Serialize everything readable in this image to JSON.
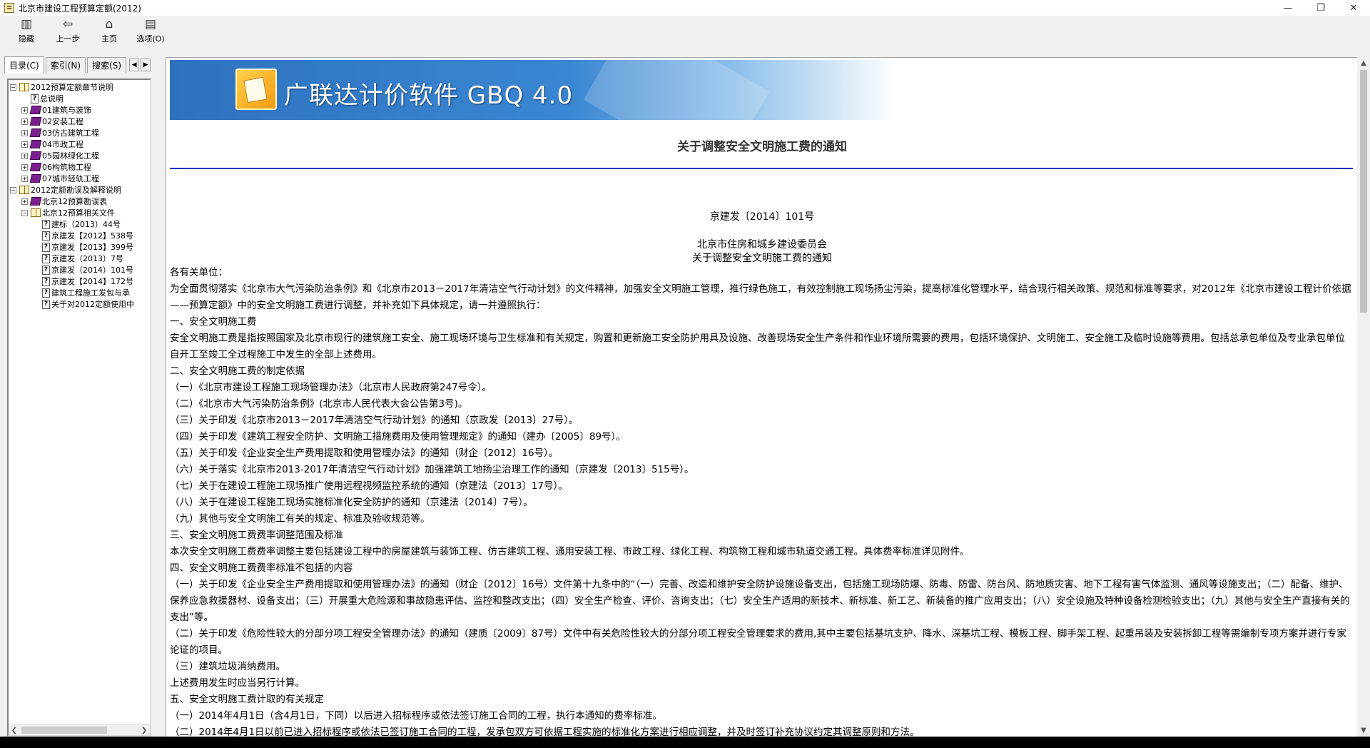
{
  "window": {
    "title": "北京市建设工程预算定额(2012)",
    "minimize": "—",
    "restore": "❐",
    "close": "✕"
  },
  "toolbar": {
    "hide": "隐藏",
    "back": "上一步",
    "home": "主页",
    "options": "选项(O)"
  },
  "nav": {
    "tabs": [
      "目录(C)",
      "索引(N)",
      "搜索(S)"
    ],
    "tree": [
      {
        "level": 0,
        "expander": "⊟",
        "icon": "openbook",
        "label": "2012预算定额章节说明"
      },
      {
        "level": 1,
        "expander": "",
        "icon": "help",
        "label": "总说明"
      },
      {
        "level": 1,
        "expander": "⊞",
        "icon": "book",
        "label": "01建筑与装饰"
      },
      {
        "level": 1,
        "expander": "⊞",
        "icon": "book",
        "label": "02安装工程"
      },
      {
        "level": 1,
        "expander": "⊞",
        "icon": "book",
        "label": "03仿古建筑工程"
      },
      {
        "level": 1,
        "expander": "⊞",
        "icon": "book",
        "label": "04市政工程"
      },
      {
        "level": 1,
        "expander": "⊞",
        "icon": "book",
        "label": "05园林绿化工程"
      },
      {
        "level": 1,
        "expander": "⊞",
        "icon": "book",
        "label": "06构筑物工程"
      },
      {
        "level": 1,
        "expander": "⊞",
        "icon": "book",
        "label": "07城市轻轨工程"
      },
      {
        "level": 0,
        "expander": "⊟",
        "icon": "openbook",
        "label": "2012定额勘误及解释说明"
      },
      {
        "level": 1,
        "expander": "⊞",
        "icon": "book",
        "label": "北京12预算勘误表"
      },
      {
        "level": 1,
        "expander": "⊟",
        "icon": "openbook",
        "label": "北京12预算相关文件"
      },
      {
        "level": 2,
        "expander": "",
        "icon": "help",
        "label": "建标（2013）44号"
      },
      {
        "level": 2,
        "expander": "",
        "icon": "help",
        "label": "京建发【2012】538号"
      },
      {
        "level": 2,
        "expander": "",
        "icon": "help",
        "label": "京建发【2013】399号"
      },
      {
        "level": 2,
        "expander": "",
        "icon": "help",
        "label": "京建发（2013）7号"
      },
      {
        "level": 2,
        "expander": "",
        "icon": "help",
        "label": "京建发（2014）101号"
      },
      {
        "level": 2,
        "expander": "",
        "icon": "help",
        "label": "京建发【2014】172号"
      },
      {
        "level": 2,
        "expander": "",
        "icon": "help",
        "label": "建筑工程施工发包与承"
      },
      {
        "level": 2,
        "expander": "",
        "icon": "help",
        "label": "关于对2012定额使用中"
      }
    ]
  },
  "content": {
    "brand": "广联达计价软件 GBQ 4.0",
    "doc_title": "关于调整安全文明施工费的通知",
    "doc_number": "京建发〔2014〕101号",
    "issuer": "北京市住房和城乡建设委员会",
    "subtitle": "关于调整安全文明施工费的通知",
    "paragraphs": [
      "各有关单位：",
      "为全面贯彻落实《北京市大气污染防治条例》和《北京市2013－2017年清洁空气行动计划》的文件精神，加强安全文明施工管理，推行绿色施工，有效控制施工现场扬尘污染，提高标准化管理水平，结合现行相关政策、规范和标准等要求，对2012年《北京市建设工程计价依据——预算定额》中的安全文明施工费进行调整，并补充如下具体规定，请一并遵照执行：",
      "一、安全文明施工费",
      "安全文明施工费是指按照国家及北京市现行的建筑施工安全、施工现场环境与卫生标准和有关规定，购置和更新施工安全防护用具及设施、改善现场安全生产条件和作业环境所需要的费用，包括环境保护、文明施工、安全施工及临时设施等费用。包括总承包单位及专业承包单位自开工至竣工全过程施工中发生的全部上述费用。",
      "二、安全文明施工费的制定依据",
      "（一）《北京市建设工程施工现场管理办法》（北京市人民政府第247号令）。",
      "（二）《北京市大气污染防治条例》(北京市人民代表大会公告第3号)。",
      "（三）关于印发《北京市2013－2017年清洁空气行动计划》的通知（京政发〔2013〕27号）。",
      "（四）关于印发《建筑工程安全防护、文明施工措施费用及使用管理规定》的通知（建办〔2005〕89号）。",
      "（五）关于印发《企业安全生产费用提取和使用管理办法》的通知（财企〔2012〕16号）。",
      "（六）关于落实《北京市2013-2017年清洁空气行动计划》加强建筑工地扬尘治理工作的通知（京建发〔2013〕515号）。",
      "（七）关于在建设工程施工现场推广使用远程视频监控系统的通知（京建法〔2013〕17号）。",
      "（八）关于在建设工程施工现场实施标准化安全防护的通知（京建法〔2014〕7号）。",
      "（九）其他与安全文明施工有关的规定、标准及验收规范等。",
      "三、安全文明施工费费率调整范围及标准",
      "本次安全文明施工费费率调整主要包括建设工程中的房屋建筑与装饰工程、仿古建筑工程、通用安装工程、市政工程、绿化工程、构筑物工程和城市轨道交通工程。具体费率标准详见附件。",
      "四、安全文明施工费费率标准不包括的内容",
      "（一）关于印发《企业安全生产费用提取和使用管理办法》的通知（财企〔2012〕16号）文件第十九条中的“（一）完善、改造和维护安全防护设施设备支出，包括施工现场防爆、防毒、防雷、防台风、防地质灾害、地下工程有害气体监测、通风等设施支出；（二）配备、维护、保养应急救援器材、设备支出；（三）开展重大危险源和事故隐患评估、监控和整改支出；（四）安全生产检查、评价、咨询支出；（七）安全生产适用的新技术、新标准、新工艺、新装备的推广应用支出；（八）安全设施及特种设备检测检验支出；（九）其他与安全生产直接有关的支出”等。",
      "（二）关于印发《危险性较大的分部分项工程安全管理办法》的通知（建质〔2009〕87号）文件中有关危险性较大的分部分项工程安全管理要求的费用,其中主要包括基坑支护、降水、深基坑工程、模板工程、脚手架工程、起重吊装及安装拆卸工程等需编制专项方案并进行专家论证的项目。",
      "（三）建筑垃圾消纳费用。",
      "上述费用发生时应当另行计算。",
      "五、安全文明施工费计取的有关规定",
      "（一）2014年4月1日（含4月1日，下同）以后进入招标程序或依法签订施工合同的工程，执行本通知的费率标准。",
      "（二）2014年4月1日以前已进入招标程序或依法已签订施工合同的工程，发承包双方可依据工程实施的标准化方案进行相应调整，并及时签订补充协议约定其调整原则和方法。"
    ]
  }
}
